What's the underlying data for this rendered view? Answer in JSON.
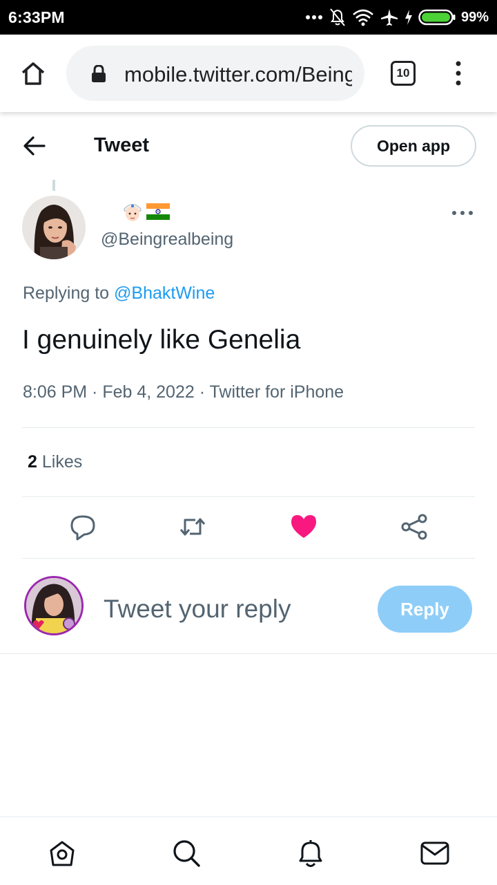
{
  "status_bar": {
    "time": "6:33PM",
    "battery_percent": "99%",
    "icons": [
      "more-dots-icon",
      "notifications-muted-icon",
      "wifi-icon",
      "airplane-mode-icon",
      "charging-icon",
      "battery-icon"
    ]
  },
  "browser": {
    "url": "mobile.twitter.com/BeingrealbeingStatus",
    "tab_count": "10",
    "icons": [
      "home-icon",
      "lock-icon",
      "overflow-menu-icon"
    ]
  },
  "header": {
    "title": "Tweet",
    "open_app_label": "Open app"
  },
  "tweet": {
    "handle": "@Beingrealbeing",
    "emojis": [
      "person-with-turban-emoji",
      "india-flag-emoji"
    ],
    "replying_prefix": "Replying to ",
    "replying_to": "@BhaktWine",
    "text": "I genuinely like Genelia",
    "time": "8:06 PM",
    "date": "Feb 4, 2022",
    "source": "Twitter for iPhone",
    "likes_count": "2",
    "likes_label": "Likes",
    "liked": true
  },
  "reply_box": {
    "placeholder": "Tweet your reply",
    "button_label": "Reply"
  },
  "colors": {
    "accent": "#1d9bf0",
    "like": "#f91880",
    "reply_button_disabled": "#8ecdf8",
    "secondary_text": "#536471"
  },
  "bottom_nav": [
    "home-icon",
    "search-icon",
    "notifications-icon",
    "messages-icon"
  ]
}
